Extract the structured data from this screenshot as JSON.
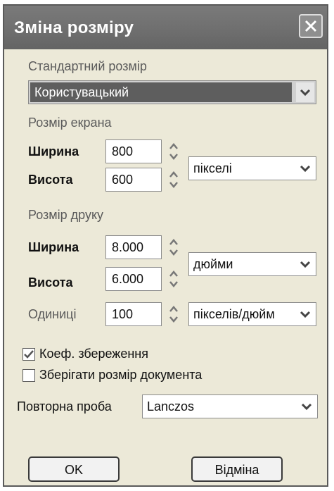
{
  "dialog": {
    "title": "Зміна розміру",
    "preset": {
      "label": "Стандартний розмір",
      "value": "Користувацький"
    },
    "screen_size": {
      "group_label": "Розмір екрана",
      "width_label": "Ширина",
      "width_value": "800",
      "height_label": "Висота",
      "height_value": "600",
      "units": "пікселі"
    },
    "print_size": {
      "group_label": "Розмір друку",
      "width_label": "Ширина",
      "width_value": "8.000",
      "height_label": "Висота",
      "height_value": "6.000",
      "units": "дюйми",
      "resolution_label": "Одиниці",
      "resolution_value": "100",
      "resolution_units": "пікселів/дюйм"
    },
    "keep_ratio": {
      "label": "Коеф. збереження",
      "checked": true
    },
    "keep_doc_size": {
      "label": "Зберігати розмір документа",
      "checked": false
    },
    "resample": {
      "label": "Повторна проба",
      "value": "Lanczos"
    },
    "buttons": {
      "ok": "OK",
      "cancel": "Відміна"
    }
  }
}
